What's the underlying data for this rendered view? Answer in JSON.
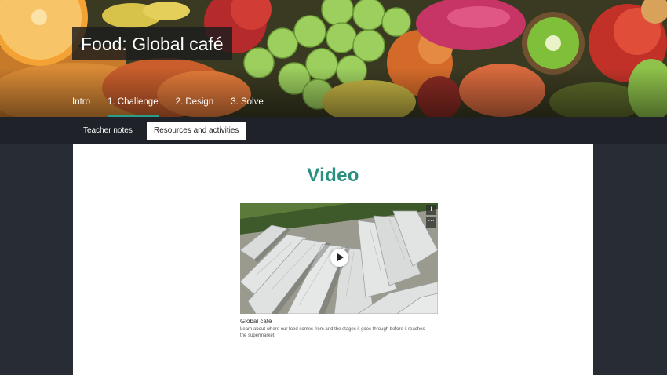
{
  "hero": {
    "title": "Food: Global café",
    "tabs": [
      {
        "label": "Intro",
        "active": false
      },
      {
        "label": "1. Challenge",
        "active": true
      },
      {
        "label": "2. Design",
        "active": false
      },
      {
        "label": "3. Solve",
        "active": false
      }
    ]
  },
  "subnav": {
    "items": [
      {
        "label": "Teacher notes",
        "active": false
      },
      {
        "label": "Resources and activities",
        "active": true
      }
    ]
  },
  "content": {
    "heading": "Video",
    "video": {
      "title": "Global café",
      "description": "Learn about where our food comes from and the stages it goes through before it reaches the supermarket.",
      "expand_icon": "+",
      "more_icon": "···"
    }
  },
  "colors": {
    "accent": "#2c9b88",
    "heading": "#2a9181",
    "nav_bg": "#1f2329",
    "page_bg": "#272c35"
  }
}
